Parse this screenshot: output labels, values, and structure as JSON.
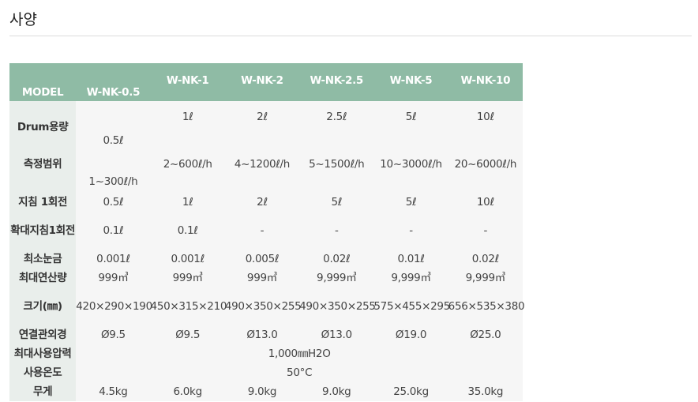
{
  "section": {
    "title": "사양"
  },
  "table": {
    "model_label": "MODEL",
    "models": [
      "W-NK-0.5",
      "W-NK-1",
      "W-NK-2",
      "W-NK-2.5",
      "W-NK-5",
      "W-NK-10"
    ],
    "rows": {
      "drum": {
        "label": "Drum용량",
        "values": [
          "0.5ℓ",
          "1ℓ",
          "2ℓ",
          "2.5ℓ",
          "5ℓ",
          "10ℓ"
        ]
      },
      "range": {
        "label": "측정범위",
        "values": [
          "1~300ℓ/h",
          "2~600ℓ/h",
          "4~1200ℓ/h",
          "5~1500ℓ/h",
          "10~3000ℓ/h",
          "20~6000ℓ/h"
        ]
      },
      "rev": {
        "label": "지침 1회전",
        "values": [
          "0.5ℓ",
          "1ℓ",
          "2ℓ",
          "5ℓ",
          "5ℓ",
          "10ℓ"
        ]
      },
      "mag": {
        "label": "확대지침1회전",
        "values": [
          "0.1ℓ",
          "0.1ℓ",
          "-",
          "-",
          "-",
          "-"
        ]
      },
      "min": {
        "label": "최소눈금",
        "values": [
          "0.001ℓ",
          "0.001ℓ",
          "0.005ℓ",
          "0.02ℓ",
          "0.01ℓ",
          "0.02ℓ"
        ]
      },
      "max": {
        "label": "최대연산량",
        "values": [
          "999㎥",
          "999㎥",
          "999㎥",
          "9,999㎥",
          "9,999㎥",
          "9,999㎥"
        ]
      },
      "size": {
        "label": "크기(㎜)",
        "values": [
          "420×290×190",
          "450×315×210",
          "490×350×255",
          "490×350×255",
          "575×455×295",
          "656×535×380"
        ]
      },
      "conn": {
        "label": "연결관외경",
        "values": [
          "Ø9.5",
          "Ø9.5",
          "Ø13.0",
          "Ø13.0",
          "Ø19.0",
          "Ø25.0"
        ]
      },
      "pressure": {
        "label": "최대사용압력",
        "value": "1,000㎜H2O"
      },
      "temp": {
        "label": "사용온도",
        "value": "50°C"
      },
      "weight": {
        "label": "무게",
        "values": [
          "4.5kg",
          "6.0kg",
          "9.0kg",
          "9.0kg",
          "25.0kg",
          "35.0kg"
        ]
      }
    }
  }
}
